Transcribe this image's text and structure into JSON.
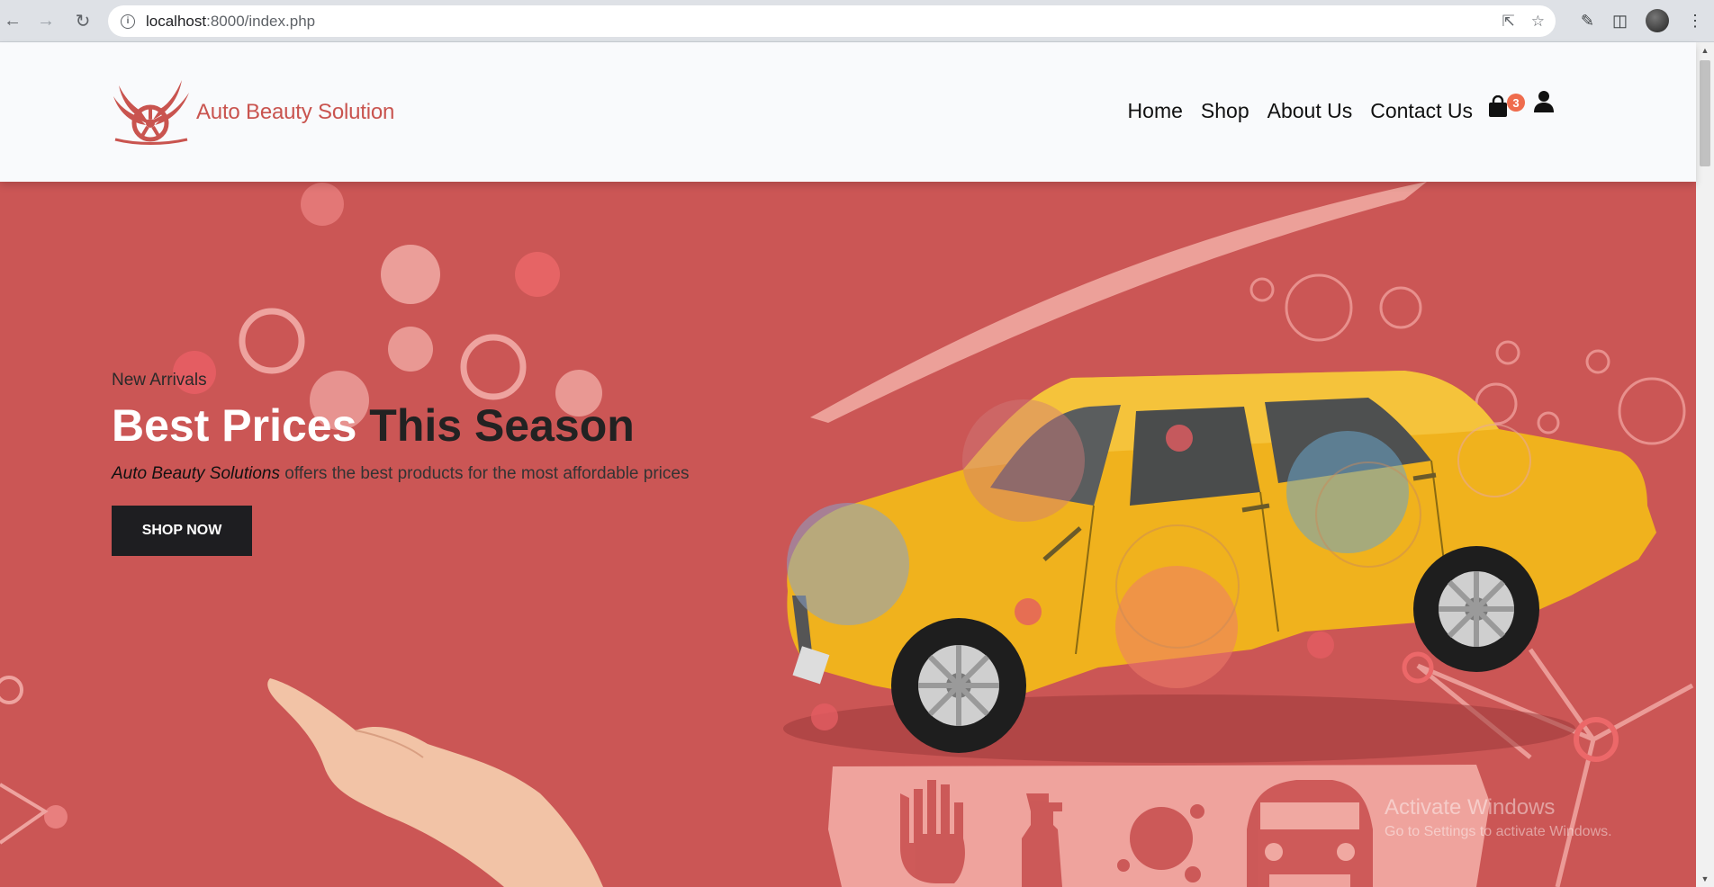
{
  "browser": {
    "url_host": "localhost",
    "url_path": ":8000/index.php"
  },
  "header": {
    "brand_name": "Auto Beauty Solution",
    "nav": [
      {
        "label": "Home"
      },
      {
        "label": "Shop"
      },
      {
        "label": "About Us"
      },
      {
        "label": "Contact Us"
      }
    ],
    "cart_count": "3"
  },
  "hero": {
    "eyebrow": "New Arrivals",
    "headline_light": "Best Prices",
    "headline_dark": " This Season",
    "tagline_brand": "Auto Beauty Solutions",
    "tagline_rest": " offers the best products for the most affordable prices",
    "cta": "SHOP NOW"
  },
  "watermark": {
    "line1": "Activate Windows",
    "line2": "Go to Settings to activate Windows."
  },
  "colors": {
    "hero_bg": "#cb5655",
    "brand": "#c9544f",
    "cta_bg": "#1e1e21",
    "badge": "#ef6c4d",
    "car_yellow": "#f0b21d"
  },
  "icons": [
    "back-arrow-icon",
    "forward-arrow-icon",
    "reload-icon",
    "info-icon",
    "share-icon",
    "star-icon",
    "extensions-icon",
    "sidepanel-icon",
    "menu-icon",
    "cart-icon",
    "user-icon"
  ]
}
